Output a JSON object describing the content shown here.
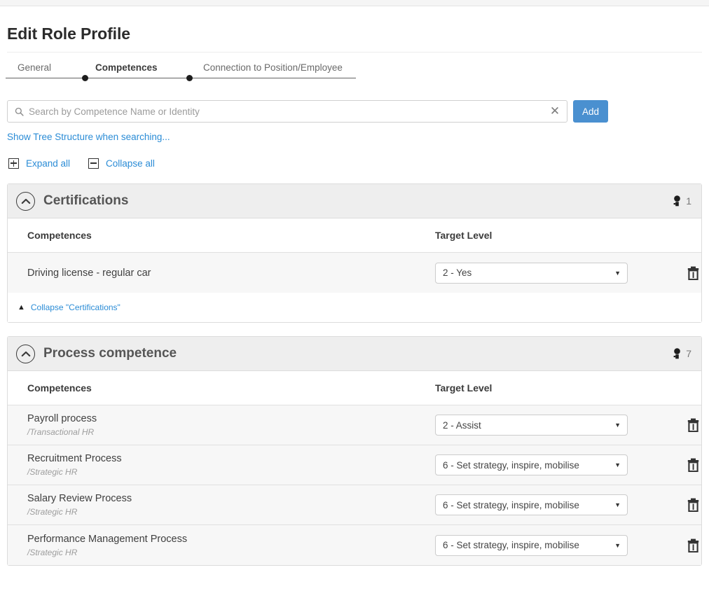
{
  "page": {
    "title": "Edit Role Profile"
  },
  "tabs": [
    {
      "label": "General",
      "active": false
    },
    {
      "label": "Competences",
      "active": true
    },
    {
      "label": "Connection to Position/Employee",
      "active": false
    }
  ],
  "search": {
    "placeholder": "Search by Competence Name or Identity",
    "value": "",
    "search_icon": "search-icon",
    "clear_icon": "close-icon",
    "clear_glyph": "✕",
    "add_label": "Add"
  },
  "links": {
    "tree_structure": "Show Tree Structure when searching...",
    "expand_all": "Expand all",
    "collapse_all": "Collapse all"
  },
  "columns": {
    "competences": "Competences",
    "target_level": "Target Level"
  },
  "colors": {
    "accent": "#4a90d0",
    "link": "#2b8cd6",
    "panel_header_bg": "#eeeeee",
    "row_bg": "#f7f7f7",
    "border": "#dcdcdc"
  },
  "sections": [
    {
      "title": "Certifications",
      "count": "1",
      "collapse_link": "Collapse \"Certifications\"",
      "rows": [
        {
          "name": "Driving license - regular car",
          "path": "",
          "level": "2 - Yes"
        }
      ]
    },
    {
      "title": "Process competence",
      "count": "7",
      "collapse_link": "",
      "rows": [
        {
          "name": "Payroll process",
          "path": "/Transactional HR",
          "level": "2 - Assist"
        },
        {
          "name": "Recruitment Process",
          "path": "/Strategic HR",
          "level": "6 - Set strategy, inspire, mobilise"
        },
        {
          "name": "Salary Review Process",
          "path": "/Strategic HR",
          "level": "6 - Set strategy, inspire, mobilise"
        },
        {
          "name": "Performance Management Process",
          "path": "/Strategic HR",
          "level": "6 - Set strategy, inspire, mobilise"
        }
      ]
    }
  ]
}
